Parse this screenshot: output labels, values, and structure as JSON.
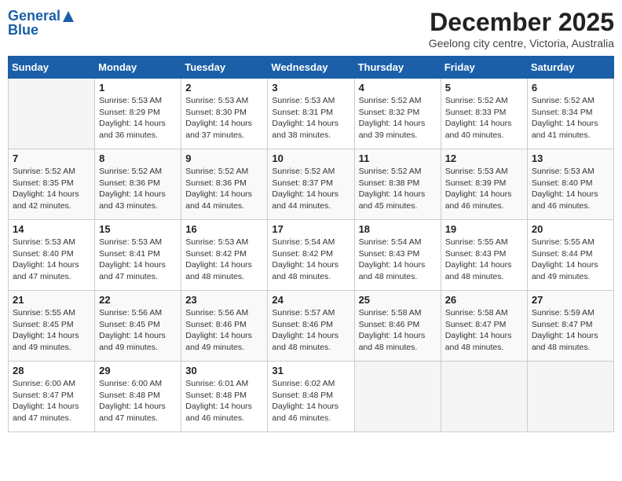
{
  "header": {
    "logo_general": "General",
    "logo_blue": "Blue",
    "month_title": "December 2025",
    "location": "Geelong city centre, Victoria, Australia"
  },
  "days_of_week": [
    "Sunday",
    "Monday",
    "Tuesday",
    "Wednesday",
    "Thursday",
    "Friday",
    "Saturday"
  ],
  "weeks": [
    [
      {
        "day": "",
        "info": ""
      },
      {
        "day": "1",
        "info": "Sunrise: 5:53 AM\nSunset: 8:29 PM\nDaylight: 14 hours\nand 36 minutes."
      },
      {
        "day": "2",
        "info": "Sunrise: 5:53 AM\nSunset: 8:30 PM\nDaylight: 14 hours\nand 37 minutes."
      },
      {
        "day": "3",
        "info": "Sunrise: 5:53 AM\nSunset: 8:31 PM\nDaylight: 14 hours\nand 38 minutes."
      },
      {
        "day": "4",
        "info": "Sunrise: 5:52 AM\nSunset: 8:32 PM\nDaylight: 14 hours\nand 39 minutes."
      },
      {
        "day": "5",
        "info": "Sunrise: 5:52 AM\nSunset: 8:33 PM\nDaylight: 14 hours\nand 40 minutes."
      },
      {
        "day": "6",
        "info": "Sunrise: 5:52 AM\nSunset: 8:34 PM\nDaylight: 14 hours\nand 41 minutes."
      }
    ],
    [
      {
        "day": "7",
        "info": "Sunrise: 5:52 AM\nSunset: 8:35 PM\nDaylight: 14 hours\nand 42 minutes."
      },
      {
        "day": "8",
        "info": "Sunrise: 5:52 AM\nSunset: 8:36 PM\nDaylight: 14 hours\nand 43 minutes."
      },
      {
        "day": "9",
        "info": "Sunrise: 5:52 AM\nSunset: 8:36 PM\nDaylight: 14 hours\nand 44 minutes."
      },
      {
        "day": "10",
        "info": "Sunrise: 5:52 AM\nSunset: 8:37 PM\nDaylight: 14 hours\nand 44 minutes."
      },
      {
        "day": "11",
        "info": "Sunrise: 5:52 AM\nSunset: 8:38 PM\nDaylight: 14 hours\nand 45 minutes."
      },
      {
        "day": "12",
        "info": "Sunrise: 5:53 AM\nSunset: 8:39 PM\nDaylight: 14 hours\nand 46 minutes."
      },
      {
        "day": "13",
        "info": "Sunrise: 5:53 AM\nSunset: 8:40 PM\nDaylight: 14 hours\nand 46 minutes."
      }
    ],
    [
      {
        "day": "14",
        "info": "Sunrise: 5:53 AM\nSunset: 8:40 PM\nDaylight: 14 hours\nand 47 minutes."
      },
      {
        "day": "15",
        "info": "Sunrise: 5:53 AM\nSunset: 8:41 PM\nDaylight: 14 hours\nand 47 minutes."
      },
      {
        "day": "16",
        "info": "Sunrise: 5:53 AM\nSunset: 8:42 PM\nDaylight: 14 hours\nand 48 minutes."
      },
      {
        "day": "17",
        "info": "Sunrise: 5:54 AM\nSunset: 8:42 PM\nDaylight: 14 hours\nand 48 minutes."
      },
      {
        "day": "18",
        "info": "Sunrise: 5:54 AM\nSunset: 8:43 PM\nDaylight: 14 hours\nand 48 minutes."
      },
      {
        "day": "19",
        "info": "Sunrise: 5:55 AM\nSunset: 8:43 PM\nDaylight: 14 hours\nand 48 minutes."
      },
      {
        "day": "20",
        "info": "Sunrise: 5:55 AM\nSunset: 8:44 PM\nDaylight: 14 hours\nand 49 minutes."
      }
    ],
    [
      {
        "day": "21",
        "info": "Sunrise: 5:55 AM\nSunset: 8:45 PM\nDaylight: 14 hours\nand 49 minutes."
      },
      {
        "day": "22",
        "info": "Sunrise: 5:56 AM\nSunset: 8:45 PM\nDaylight: 14 hours\nand 49 minutes."
      },
      {
        "day": "23",
        "info": "Sunrise: 5:56 AM\nSunset: 8:46 PM\nDaylight: 14 hours\nand 49 minutes."
      },
      {
        "day": "24",
        "info": "Sunrise: 5:57 AM\nSunset: 8:46 PM\nDaylight: 14 hours\nand 48 minutes."
      },
      {
        "day": "25",
        "info": "Sunrise: 5:58 AM\nSunset: 8:46 PM\nDaylight: 14 hours\nand 48 minutes."
      },
      {
        "day": "26",
        "info": "Sunrise: 5:58 AM\nSunset: 8:47 PM\nDaylight: 14 hours\nand 48 minutes."
      },
      {
        "day": "27",
        "info": "Sunrise: 5:59 AM\nSunset: 8:47 PM\nDaylight: 14 hours\nand 48 minutes."
      }
    ],
    [
      {
        "day": "28",
        "info": "Sunrise: 6:00 AM\nSunset: 8:47 PM\nDaylight: 14 hours\nand 47 minutes."
      },
      {
        "day": "29",
        "info": "Sunrise: 6:00 AM\nSunset: 8:48 PM\nDaylight: 14 hours\nand 47 minutes."
      },
      {
        "day": "30",
        "info": "Sunrise: 6:01 AM\nSunset: 8:48 PM\nDaylight: 14 hours\nand 46 minutes."
      },
      {
        "day": "31",
        "info": "Sunrise: 6:02 AM\nSunset: 8:48 PM\nDaylight: 14 hours\nand 46 minutes."
      },
      {
        "day": "",
        "info": ""
      },
      {
        "day": "",
        "info": ""
      },
      {
        "day": "",
        "info": ""
      }
    ]
  ]
}
